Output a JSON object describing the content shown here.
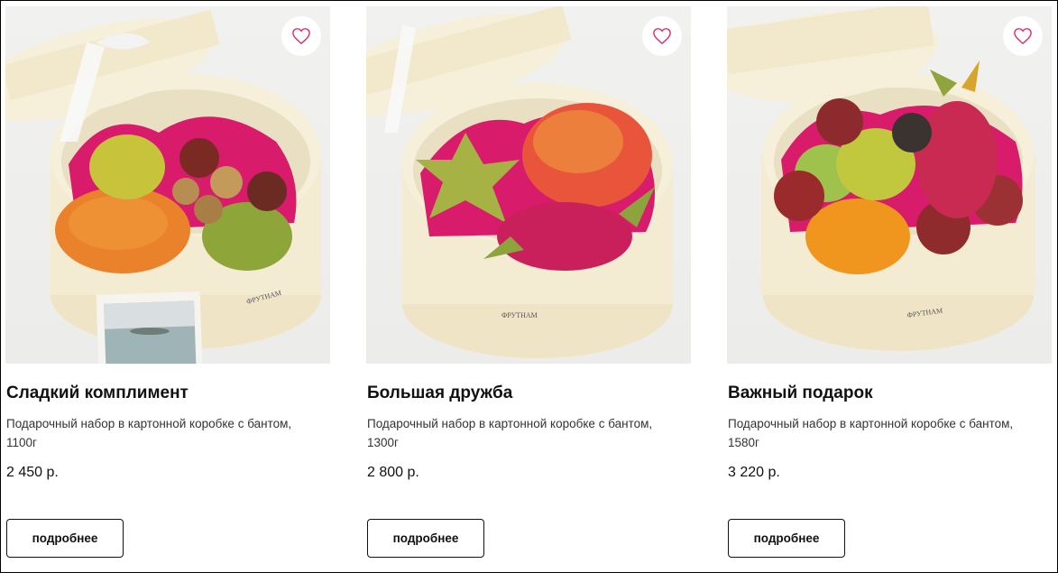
{
  "products": [
    {
      "title": "Сладкий комплимент",
      "description": "Подарочный набор в картонной коробке с бантом, 1100г",
      "price": "2 450 р.",
      "button_label": "подробнее",
      "image_icon": "fruit-gift-box-photo"
    },
    {
      "title": "Большая дружба",
      "description": "Подарочный набор в картонной коробке с бантом, 1300г",
      "price": "2 800 р.",
      "button_label": "подробнее",
      "image_icon": "fruit-gift-box-photo"
    },
    {
      "title": "Важный подарок",
      "description": "Подарочный набор в картонной коробке с бантом, 1580г",
      "price": "3 220 р.",
      "button_label": "подробнее",
      "image_icon": "fruit-gift-box-photo"
    }
  ],
  "favorite_icon": "heart-icon",
  "colors": {
    "accent": "#d6336c",
    "box": "#f4ecd2",
    "tissue": "#d81b6a",
    "text": "#111111"
  }
}
